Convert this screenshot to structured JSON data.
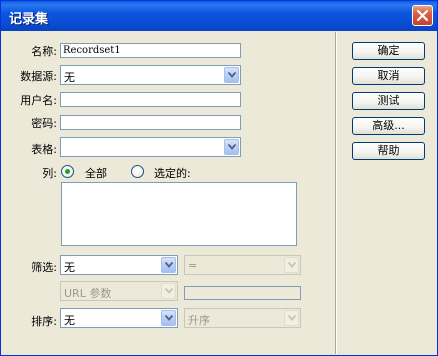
{
  "window": {
    "title": "记录集"
  },
  "form": {
    "name_label": "名称:",
    "name_value": "Recordset1",
    "datasource_label": "数据源:",
    "datasource_value": "无",
    "username_label": "用户名:",
    "username_value": "",
    "password_label": "密码:",
    "password_value": "",
    "table_label": "表格:",
    "table_value": "",
    "columns_label": "列:",
    "columns_all_label": "全部",
    "columns_selected_label": "选定的:",
    "columns_selected_option": "all",
    "filter_label": "筛选:",
    "filter_value": "无",
    "filter_operator_value": "=",
    "filter_source_value": "URL 参数",
    "filter_param_value": "",
    "sort_label": "排序:",
    "sort_value": "无",
    "sort_order_value": "升序"
  },
  "buttons": {
    "ok": "确定",
    "cancel": "取消",
    "test": "测试",
    "advanced": "高级...",
    "help": "帮助"
  },
  "icons": {
    "close": "close-icon",
    "dropdown": "chevron-down-icon",
    "radio_selected_color": "#21a121"
  },
  "colors": {
    "titlebar": "#0a55e0",
    "dialog_bg": "#ece9d8",
    "field_border": "#7f9db9",
    "button_border": "#003c74"
  }
}
